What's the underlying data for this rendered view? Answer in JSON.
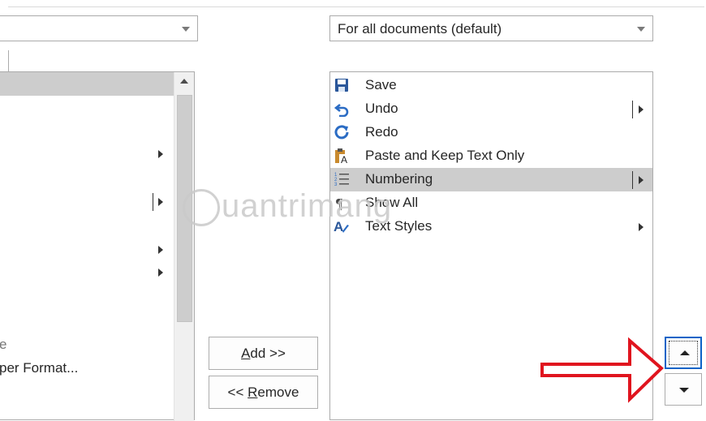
{
  "left_combo": {
    "value": ""
  },
  "right_combo": {
    "value": "For all documents (default)"
  },
  "left_list": {
    "partial_items": [
      "e",
      "per Format..."
    ]
  },
  "buttons": {
    "add_label": "Add >>",
    "remove_label": "<< Remove"
  },
  "right_list": {
    "items": [
      {
        "label": "Save",
        "icon": "save-icon"
      },
      {
        "label": "Undo",
        "icon": "undo-icon"
      },
      {
        "label": "Redo",
        "icon": "redo-icon"
      },
      {
        "label": "Paste and Keep Text Only",
        "icon": "paste-text-only-icon"
      },
      {
        "label": "Numbering",
        "icon": "numbering-icon"
      },
      {
        "label": "Show All",
        "icon": "pilcrow-icon"
      },
      {
        "label": "Text Styles",
        "icon": "text-styles-icon"
      }
    ],
    "selected": "Numbering"
  },
  "watermark": "uantrimang",
  "colors": {
    "selection": "#cdcdcd",
    "arrow": "#e0141e",
    "focus": "#0b63c7"
  }
}
